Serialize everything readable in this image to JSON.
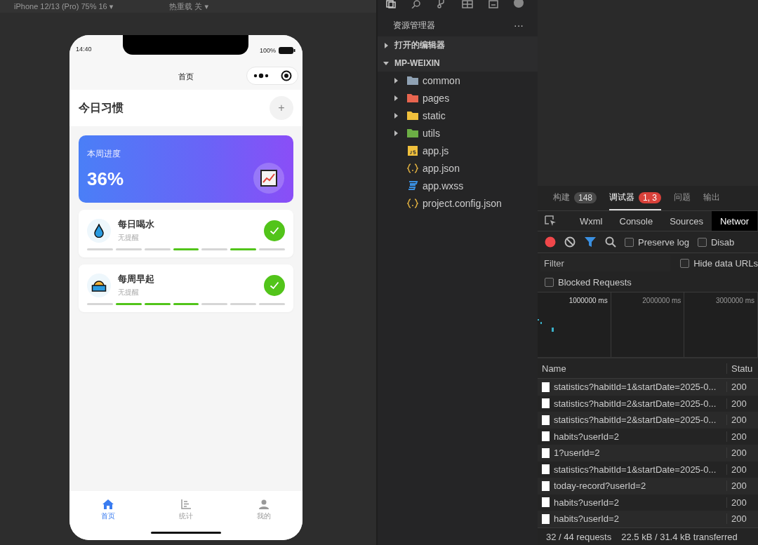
{
  "toolbar": {
    "device": "iPhone 12/13 (Pro) 75% 16 ▾",
    "hot_reload": "热重载 关 ▾"
  },
  "phone": {
    "status_bar": {
      "time": "14:40",
      "battery": "100%"
    },
    "nav_title": "首页",
    "header": {
      "title": "今日习惯",
      "add": "+"
    },
    "progress_card": {
      "label": "本周进度",
      "value": "36%"
    },
    "habits": [
      {
        "name": "每日喝水",
        "reminder": "无提醒",
        "kind": "water",
        "checked": true,
        "week": [
          false,
          false,
          false,
          true,
          false,
          true,
          false
        ]
      },
      {
        "name": "每周早起",
        "reminder": "无提醒",
        "kind": "sunrise",
        "checked": true,
        "week": [
          false,
          true,
          true,
          true,
          false,
          false,
          false
        ]
      }
    ],
    "tabs": [
      {
        "label": "首页",
        "kind": "home",
        "selected": true
      },
      {
        "label": "统计",
        "kind": "chart",
        "selected": false
      },
      {
        "label": "我的",
        "kind": "user",
        "selected": false
      }
    ]
  },
  "explorer": {
    "title": "资源管理器",
    "more": "···",
    "sections": [
      {
        "label": "打开的编辑器",
        "expanded": false
      },
      {
        "label": "MP-WEIXIN",
        "expanded": true
      }
    ],
    "items": [
      {
        "name": "common",
        "kind": "folder",
        "color": "#8fa1b3",
        "expanded": false
      },
      {
        "name": "pages",
        "kind": "folder",
        "color": "#e8654f",
        "expanded": false
      },
      {
        "name": "static",
        "kind": "folder",
        "color": "#f0c03c",
        "expanded": false
      },
      {
        "name": "utils",
        "kind": "folder",
        "color": "#6cae45",
        "expanded": false
      },
      {
        "name": "app.js",
        "kind": "js"
      },
      {
        "name": "app.json",
        "kind": "json"
      },
      {
        "name": "app.wxss",
        "kind": "css"
      },
      {
        "name": "project.config.json",
        "kind": "json"
      }
    ]
  },
  "devtools": {
    "panel_tabs": [
      {
        "label": "构建",
        "badge": "148",
        "error": false,
        "selected": false
      },
      {
        "label": "调试器",
        "badge": "1, 3",
        "error": true,
        "selected": true
      },
      {
        "label": "问题",
        "selected": false
      },
      {
        "label": "输出",
        "selected": false
      }
    ],
    "tool_tabs": [
      {
        "label": "Wxml",
        "selected": false
      },
      {
        "label": "Console",
        "selected": false
      },
      {
        "label": "Sources",
        "selected": false
      },
      {
        "label": "Networ",
        "selected": true
      }
    ],
    "options": [
      {
        "label": "Preserve log",
        "checked": false
      },
      {
        "label": "Disab",
        "checked": false
      }
    ],
    "filter": {
      "placeholder": "Filter"
    },
    "hide_data_urls": {
      "label": "Hide data URLs",
      "checked": false
    },
    "blocked_requests": {
      "label": "Blocked Requests",
      "checked": false
    },
    "timeline_ticks": [
      "1000000 ms",
      "2000000 ms",
      "3000000 ms"
    ],
    "columns": [
      "Name",
      "Statu"
    ],
    "rows": [
      {
        "name": "statistics?habitId=1&startDate=2025-0...",
        "status": "200"
      },
      {
        "name": "statistics?habitId=2&startDate=2025-0...",
        "status": "200"
      },
      {
        "name": "statistics?habitId=2&startDate=2025-0...",
        "status": "200"
      },
      {
        "name": "habits?userId=2",
        "status": "200"
      },
      {
        "name": "1?userId=2",
        "status": "200"
      },
      {
        "name": "statistics?habitId=1&startDate=2025-0...",
        "status": "200"
      },
      {
        "name": "today-record?userId=2",
        "status": "200"
      },
      {
        "name": "habits?userId=2",
        "status": "200"
      },
      {
        "name": "habits?userId=2",
        "status": "200"
      }
    ],
    "summary": {
      "requests": "32 / 44 requests",
      "transferred": "22.5 kB / 31.4 kB transferred"
    }
  }
}
